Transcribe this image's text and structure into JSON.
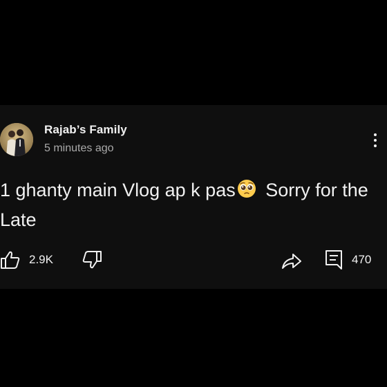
{
  "post": {
    "channel_name": "Rajab’s Family",
    "time_ago": "5 minutes ago",
    "text_part1": "1 ghanty main Vlog ap k pas",
    "emoji": "pleading-face-emoji",
    "text_part2": "Sorry for the Late",
    "like_count": "2.9K",
    "comment_count": "470"
  },
  "icons": {
    "like": "thumbs-up-icon",
    "dislike": "thumbs-down-icon",
    "share": "share-arrow-icon",
    "comment": "comment-icon",
    "menu": "vertical-dots-icon"
  },
  "colors": {
    "background": "#000000",
    "card": "#0f0f0f",
    "text_primary": "#f1f1f1",
    "text_secondary": "#aaaaaa"
  }
}
